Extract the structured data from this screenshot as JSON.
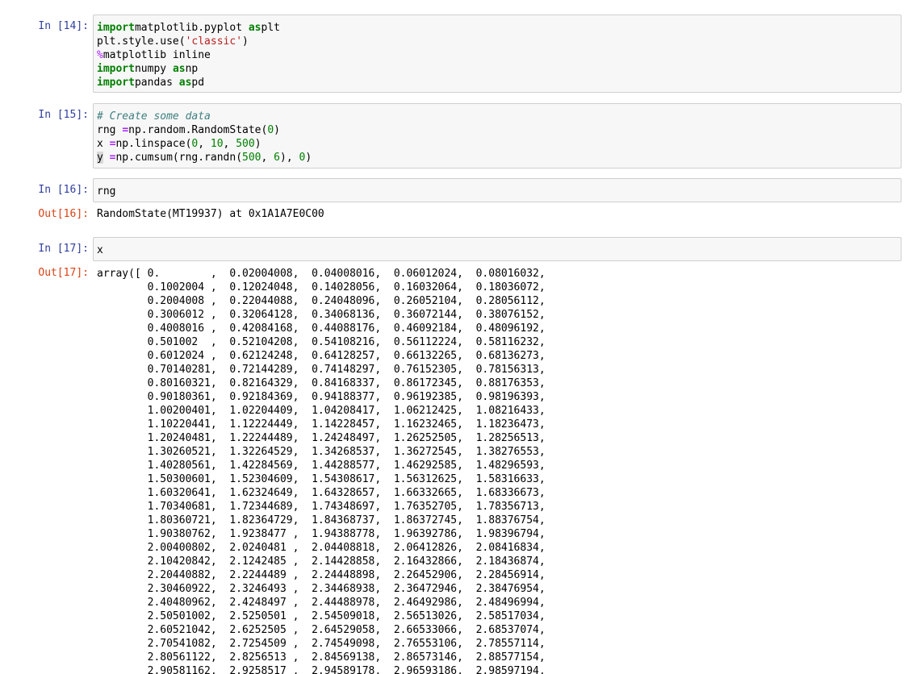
{
  "cells": {
    "c14": {
      "prompt": "In [14]:",
      "lines": [
        [
          [
            "kw",
            "import"
          ],
          [
            "",
            "matplotlib.pyplot "
          ],
          [
            "kw",
            "as"
          ],
          [
            "",
            "plt"
          ]
        ],
        [
          [
            "",
            "plt.style.use("
          ],
          [
            "str",
            "'classic'"
          ],
          [
            "",
            ")"
          ]
        ],
        [
          [
            "mg",
            "%"
          ],
          [
            "",
            "matplotlib inline"
          ]
        ],
        [
          [
            "kw",
            "import"
          ],
          [
            "",
            "numpy "
          ],
          [
            "kw",
            "as"
          ],
          [
            "",
            "np"
          ]
        ],
        [
          [
            "kw",
            "import"
          ],
          [
            "",
            "pandas "
          ],
          [
            "kw",
            "as"
          ],
          [
            "",
            "pd"
          ]
        ]
      ]
    },
    "c15": {
      "prompt": "In [15]:",
      "lines": [
        [
          [
            "cm",
            "# Create some data"
          ]
        ],
        [
          [
            "",
            "rng "
          ],
          [
            "op",
            "="
          ],
          [
            "",
            "np.random.RandomState("
          ],
          [
            "num",
            "0"
          ],
          [
            "",
            ")"
          ]
        ],
        [
          [
            "",
            "x "
          ],
          [
            "op",
            "="
          ],
          [
            "",
            "np.linspace("
          ],
          [
            "num",
            "0"
          ],
          [
            "",
            ", "
          ],
          [
            "num",
            "10"
          ],
          [
            "",
            ", "
          ],
          [
            "num",
            "500"
          ],
          [
            "",
            ")"
          ]
        ],
        [
          [
            "cur",
            "y"
          ],
          [
            "",
            ""
          ],
          [
            "op",
            " ="
          ],
          [
            "",
            "np.cumsum(rng.randn("
          ],
          [
            "num",
            "500"
          ],
          [
            "",
            ", "
          ],
          [
            "num",
            "6"
          ],
          [
            "",
            "), "
          ],
          [
            "num",
            "0"
          ],
          [
            "",
            ")"
          ]
        ]
      ]
    },
    "c16": {
      "prompt": "In [16]:",
      "code": "rng",
      "out_prompt": "Out[16]:",
      "output": "RandomState(MT19937) at 0x1A1A7E0C00"
    },
    "c17": {
      "prompt": "In [17]:",
      "code": "x",
      "out_prompt": "Out[17]:",
      "output_rows": [
        "array([ 0.        ,  0.02004008,  0.04008016,  0.06012024,  0.08016032,",
        "        0.1002004 ,  0.12024048,  0.14028056,  0.16032064,  0.18036072,",
        "        0.2004008 ,  0.22044088,  0.24048096,  0.26052104,  0.28056112,",
        "        0.3006012 ,  0.32064128,  0.34068136,  0.36072144,  0.38076152,",
        "        0.4008016 ,  0.42084168,  0.44088176,  0.46092184,  0.48096192,",
        "        0.501002  ,  0.52104208,  0.54108216,  0.56112224,  0.58116232,",
        "        0.6012024 ,  0.62124248,  0.64128257,  0.66132265,  0.68136273,",
        "        0.70140281,  0.72144289,  0.74148297,  0.76152305,  0.78156313,",
        "        0.80160321,  0.82164329,  0.84168337,  0.86172345,  0.88176353,",
        "        0.90180361,  0.92184369,  0.94188377,  0.96192385,  0.98196393,",
        "        1.00200401,  1.02204409,  1.04208417,  1.06212425,  1.08216433,",
        "        1.10220441,  1.12224449,  1.14228457,  1.16232465,  1.18236473,",
        "        1.20240481,  1.22244489,  1.24248497,  1.26252505,  1.28256513,",
        "        1.30260521,  1.32264529,  1.34268537,  1.36272545,  1.38276553,",
        "        1.40280561,  1.42284569,  1.44288577,  1.46292585,  1.48296593,",
        "        1.50300601,  1.52304609,  1.54308617,  1.56312625,  1.58316633,",
        "        1.60320641,  1.62324649,  1.64328657,  1.66332665,  1.68336673,",
        "        1.70340681,  1.72344689,  1.74348697,  1.76352705,  1.78356713,",
        "        1.80360721,  1.82364729,  1.84368737,  1.86372745,  1.88376754,",
        "        1.90380762,  1.9238477 ,  1.94388778,  1.96392786,  1.98396794,",
        "        2.00400802,  2.0240481 ,  2.04408818,  2.06412826,  2.08416834,",
        "        2.10420842,  2.1242485 ,  2.14428858,  2.16432866,  2.18436874,",
        "        2.20440882,  2.2244489 ,  2.24448898,  2.26452906,  2.28456914,",
        "        2.30460922,  2.3246493 ,  2.34468938,  2.36472946,  2.38476954,",
        "        2.40480962,  2.4248497 ,  2.44488978,  2.46492986,  2.48496994,",
        "        2.50501002,  2.5250501 ,  2.54509018,  2.56513026,  2.58517034,",
        "        2.60521042,  2.6252505 ,  2.64529058,  2.66533066,  2.68537074,",
        "        2.70541082,  2.7254509 ,  2.74549098,  2.76553106,  2.78557114,",
        "        2.80561122,  2.8256513 ,  2.84569138,  2.86573146,  2.88577154,",
        "        2.90581162,  2.9258517 ,  2.94589178,  2.96593186,  2.98597194,"
      ]
    }
  }
}
